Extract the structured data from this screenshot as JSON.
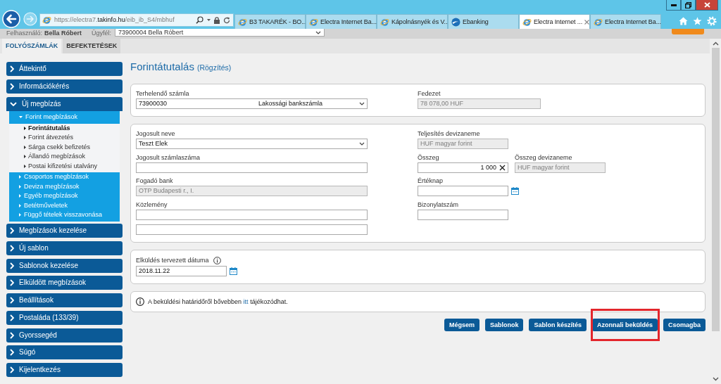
{
  "browser": {
    "address": "https://electra7.**takinfo.hu**/eib_ib_S4/mbhuf",
    "tabs": [
      {
        "title": "B3 TAKARÉK - BO...",
        "kind": "page",
        "selected": false
      },
      {
        "title": "Electra Internet Ba...",
        "kind": "page",
        "selected": false
      },
      {
        "title": "Kápolnásnyék és V...",
        "kind": "page",
        "selected": false
      },
      {
        "title": "Ebanking",
        "kind": "site",
        "selected": false
      },
      {
        "title": "Electra Internet ...",
        "kind": "page",
        "selected": true
      },
      {
        "title": "Electra Internet Ba...",
        "kind": "page",
        "selected": false
      }
    ]
  },
  "header": {
    "user_label": "Felhasználó:",
    "user_name": "Bella Róbert",
    "client_label": "Ügyfél:",
    "client_value": "73900004 Bella Róbert"
  },
  "section_tabs": [
    {
      "label": "FOLYÓSZÁMLÁK",
      "selected": true
    },
    {
      "label": "BEFEKTETÉSEK",
      "selected": false
    }
  ],
  "sidebar": {
    "items": [
      {
        "label": "Áttekintő",
        "expanded": false
      },
      {
        "label": "Információkérés",
        "expanded": false
      },
      {
        "label": "Új megbízás",
        "expanded": true,
        "children": [
          {
            "label": "Forint megbízások",
            "expanded": true,
            "children": [
              {
                "label": "Forintátutalás",
                "selected": true
              },
              {
                "label": "Forint átvezetés",
                "selected": false
              },
              {
                "label": "Sárga csekk befizetés",
                "selected": false
              },
              {
                "label": "Állandó megbízások",
                "selected": false
              },
              {
                "label": "Postai kifizetési utalvány",
                "selected": false
              }
            ]
          },
          {
            "label": "Csoportos megbízások",
            "expanded": false
          },
          {
            "label": "Deviza megbízások",
            "expanded": false
          },
          {
            "label": "Egyéb megbízások",
            "expanded": false
          },
          {
            "label": "Betétműveletek",
            "expanded": false
          },
          {
            "label": "Függő tételek visszavonása",
            "expanded": false
          }
        ]
      },
      {
        "label": "Megbízások kezelése",
        "expanded": false
      },
      {
        "label": "Új sablon",
        "expanded": false
      },
      {
        "label": "Sablonok kezelése",
        "expanded": false
      },
      {
        "label": "Elküldött megbízások",
        "expanded": false
      },
      {
        "label": "Beállítások",
        "expanded": false
      },
      {
        "label": "Postaláda (133/39)",
        "expanded": false
      },
      {
        "label": "Gyorssegéd",
        "expanded": false
      },
      {
        "label": "Súgó",
        "expanded": false
      },
      {
        "label": "Kijelentkezés",
        "expanded": false
      }
    ]
  },
  "page": {
    "title": "Forintátutalás",
    "subtitle": "(Rögzítés)"
  },
  "panels": [
    {
      "left": [
        [
          {
            "kind": "select",
            "label": "Terhelendő számla",
            "value": "73900030",
            "value_note": "Lakossági bankszámla"
          }
        ]
      ],
      "right": [
        [
          {
            "kind": "balance",
            "label": "Fedezet",
            "value": "78 078,00 HUF"
          }
        ]
      ]
    },
    {
      "left": [
        [
          {
            "kind": "select",
            "label": "Jogosult neve",
            "value": "Teszt Elek"
          }
        ],
        [
          {
            "kind": "input",
            "label": "Jogosult számlaszáma"
          }
        ],
        [
          {
            "kind": "readonly",
            "label": "Fogadó bank",
            "value": "OTP Budapesti r., I."
          }
        ],
        [
          {
            "kind": "input",
            "label": "Közlemény"
          }
        ],
        [
          {
            "kind": "input"
          }
        ]
      ],
      "right": [
        [
          {
            "kind": "readonly",
            "label": "Teljesítés devizaneme",
            "value": "HUF magyar forint"
          }
        ],
        [
          {
            "kind": "amount",
            "label": "Összeg",
            "value": "1 000"
          },
          {
            "kind": "readonly",
            "label": "Összeg devizaneme",
            "value": "HUF magyar forint"
          }
        ],
        [
          {
            "kind": "date",
            "label": "Értéknap"
          }
        ],
        [
          {
            "kind": "input",
            "label": "Bizonylatszám"
          }
        ]
      ]
    },
    {
      "left": [
        [
          {
            "kind": "date",
            "label": "Elküldés tervezett dátuma",
            "info": true,
            "value": "2018.11.22"
          }
        ]
      ]
    },
    {
      "notice": {
        "text_before": "A beküldési határidőről bővebben",
        "link": "itt",
        "text_after": "tájékozódhat."
      }
    }
  ],
  "buttons": [
    {
      "label": "Mégsem",
      "highlighted": false
    },
    {
      "label": "Sablonok",
      "highlighted": false
    },
    {
      "label": "Sablon készítés",
      "highlighted": false
    },
    {
      "label": "Azonnali beküldés",
      "highlighted": true
    },
    {
      "label": "Csomagba",
      "highlighted": false
    }
  ]
}
